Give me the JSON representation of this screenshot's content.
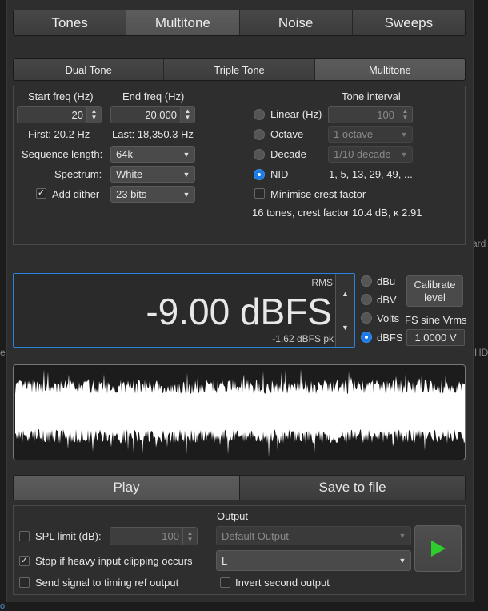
{
  "background": {
    "right_text": "ard",
    "left_text": "ec",
    "right_text2": "HD",
    "bottom_text": "o"
  },
  "main_tabs": [
    {
      "label": "Tones",
      "active": false
    },
    {
      "label": "Multitone",
      "active": true
    },
    {
      "label": "Noise",
      "active": false
    },
    {
      "label": "Sweeps",
      "active": false
    }
  ],
  "sub_tabs": [
    {
      "label": "Dual Tone",
      "active": false
    },
    {
      "label": "Triple Tone",
      "active": false
    },
    {
      "label": "Multitone",
      "active": true
    }
  ],
  "settings": {
    "start_freq_label": "Start freq (Hz)",
    "start_freq_value": "20",
    "end_freq_label": "End freq (Hz)",
    "end_freq_value": "20,000",
    "first_text": "First: 20.2 Hz",
    "last_text": "Last: 18,350.3 Hz",
    "sequence_length_label": "Sequence length:",
    "sequence_length_value": "64k",
    "spectrum_label": "Spectrum:",
    "spectrum_value": "White",
    "add_dither_label": "Add dither",
    "add_dither_checked": true,
    "dither_bits_value": "23 bits"
  },
  "tone_interval": {
    "title": "Tone interval",
    "linear_label": "Linear (Hz)",
    "linear_value": "100",
    "octave_label": "Octave",
    "octave_value": "1 octave",
    "decade_label": "Decade",
    "decade_value": "1/10 decade",
    "nid_label": "NID",
    "nid_value": "1, 5, 13, 29, 49, ...",
    "selected": "NID",
    "minimise_crest_label": "Minimise crest factor",
    "minimise_crest_checked": false,
    "summary": "16 tones, crest factor 10.4 dB, κ 2.91"
  },
  "level": {
    "mode_label": "RMS",
    "value": "-9.00 dBFS",
    "peak": "-1.62 dBFS pk",
    "units": [
      {
        "label": "dBu",
        "selected": false
      },
      {
        "label": "dBV",
        "selected": false
      },
      {
        "label": "Volts",
        "selected": false
      },
      {
        "label": "dBFS",
        "selected": true
      }
    ],
    "calibrate_label_1": "Calibrate",
    "calibrate_label_2": "level",
    "fs_sine_label": "FS sine Vrms",
    "fs_sine_value": "1.0000 V"
  },
  "actions": {
    "play_label": "Play",
    "save_label": "Save to file"
  },
  "output": {
    "title": "Output",
    "spl_limit_label": "SPL limit (dB):",
    "spl_limit_checked": false,
    "spl_limit_value": "100",
    "device_value": "Default Output",
    "channel_value": "L",
    "stop_clipping_label": "Stop if heavy input clipping occurs",
    "stop_clipping_checked": true,
    "timing_ref_label": "Send signal to timing ref output",
    "timing_ref_checked": false,
    "invert_second_label": "Invert second output",
    "invert_second_checked": false
  },
  "colors": {
    "accent": "#1a7ae8",
    "play_green": "#2ecc2e",
    "panel": "#2e2e2e"
  }
}
